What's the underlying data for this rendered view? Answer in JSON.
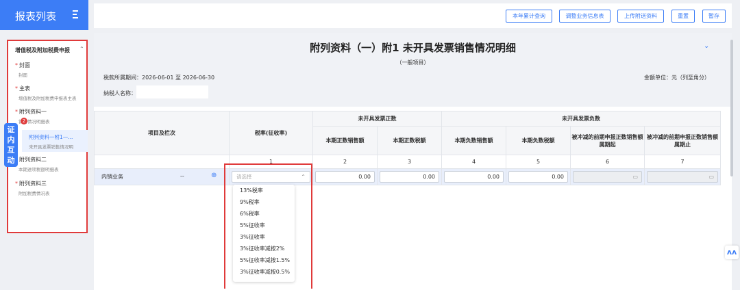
{
  "sidebar": {
    "header_title": "报表列表",
    "group": {
      "label": "增值税及附加税费申报",
      "items": [
        {
          "label": "封面",
          "sub": "封面",
          "required": "*"
        },
        {
          "label": "主表",
          "sub": "增值税及附加税费申报表主表",
          "required": "*"
        },
        {
          "label": "附列资料一",
          "sub": "销售情况明细表",
          "required": "*"
        },
        {
          "label": "附列资料二",
          "sub": "本期进项税额明细表",
          "required": "*"
        },
        {
          "label": "附列资料三",
          "sub": "附加税费情况表",
          "required": "*"
        }
      ],
      "active_sub": {
        "label": "附列资料一附1—...",
        "sub": "未开具发票销售情况明"
      }
    },
    "badge": "2",
    "float_tab": "证\n内\n互\n动"
  },
  "toolbar": {
    "buttons": [
      "本年累计查询",
      "调整业务信息表",
      "上传附送资料",
      "重置",
      "暂存"
    ]
  },
  "header": {
    "title": "附列资料（一）附1 未开具发票销售情况明细",
    "subtitle": "（一般项目）",
    "period": "税款所属期间：2026-06-01 至 2026-06-30",
    "unit": "金额单位：元（列至角分）",
    "payer_label": "纳税人名称："
  },
  "table": {
    "col_item": "项目及栏次",
    "col_rate": "税率(征收率)",
    "group_positive": "未开具发票正数",
    "group_negative": "未开具发票负数",
    "cols": [
      "本期正数销售额",
      "本期正数税额",
      "本期负数销售额",
      "本期负数税额",
      "被冲减的前期申报正数销售额属期起",
      "被冲减的前期申报正数销售额属期止"
    ],
    "nums": [
      "1",
      "2",
      "3",
      "4",
      "5",
      "6",
      "7"
    ],
    "row": {
      "label": "内销业务",
      "dash": "--",
      "select_placeholder": "请选择",
      "values": [
        "0.00",
        "0.00",
        "0.00",
        "0.00"
      ]
    }
  },
  "dropdown": {
    "options": [
      "13%税率",
      "9%税率",
      "6%税率",
      "5%征收率",
      "3%征收率",
      "3%征收率减按2%",
      "5%征收率减按1.5%",
      "3%征收率减按0.5%"
    ]
  },
  "fab_label": "ʌʌ"
}
